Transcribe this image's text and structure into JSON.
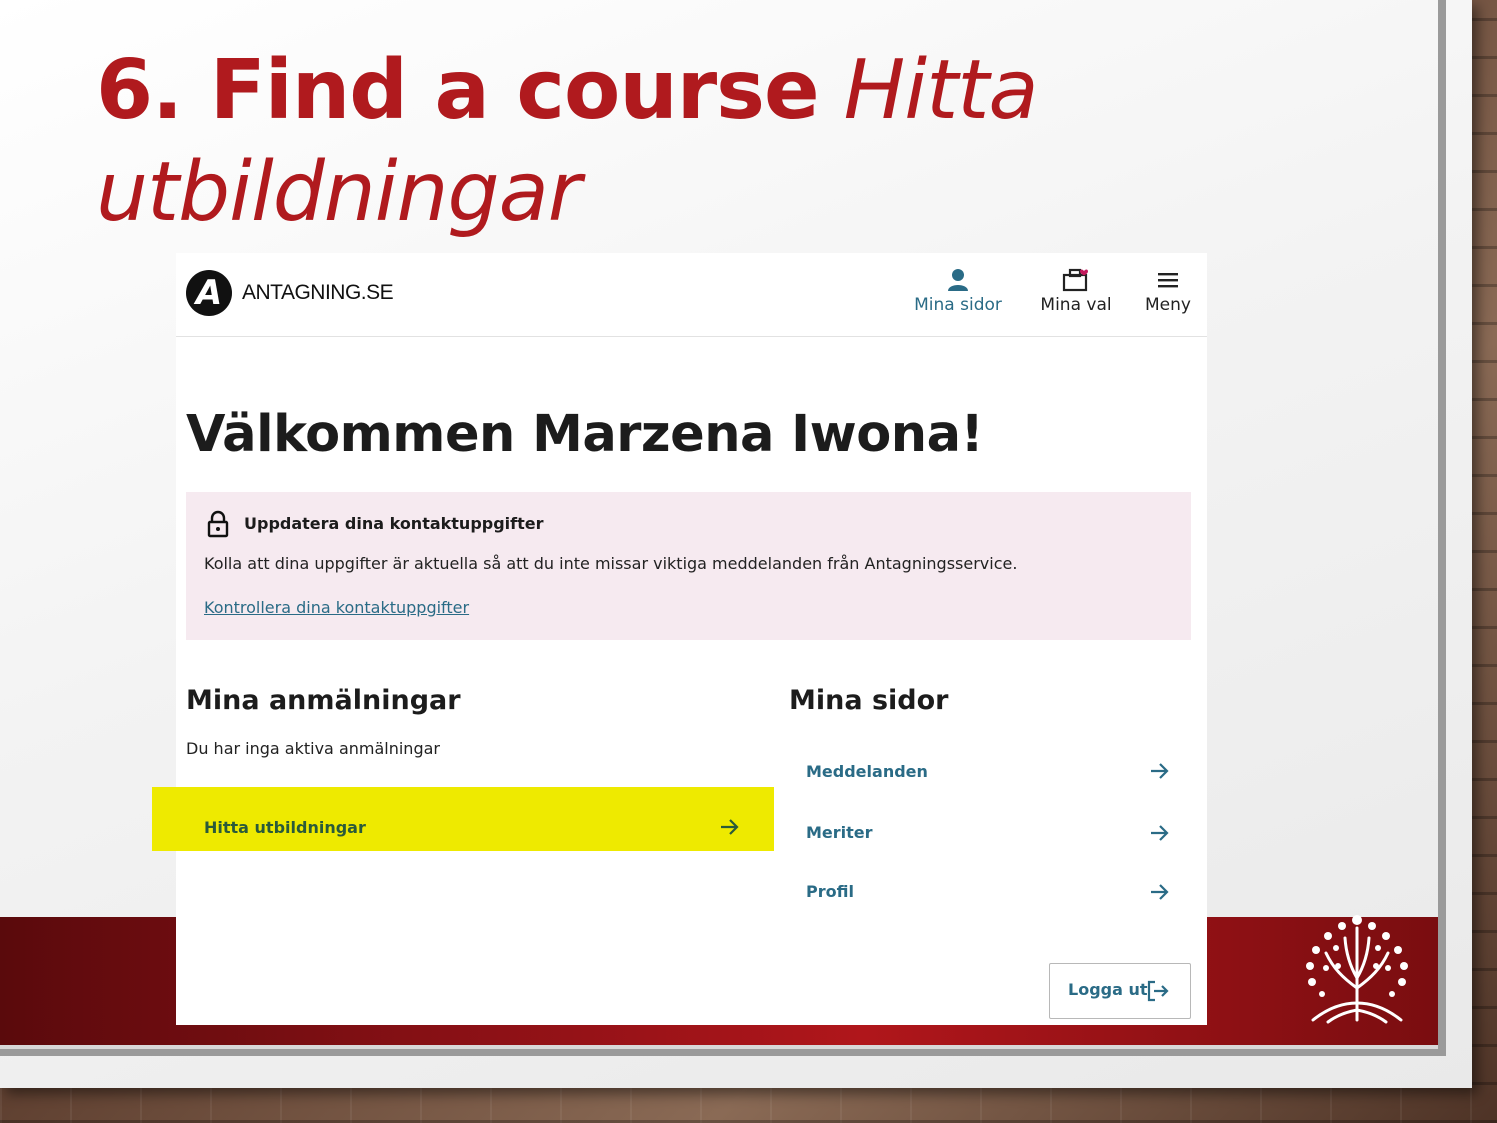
{
  "slide": {
    "title_bold": "6. Find a course",
    "title_italic": "Hitta utbildningar"
  },
  "site": {
    "logo_letter": "A",
    "brand": "ANTAGNING.SE",
    "nav": [
      {
        "label": "Mina sidor",
        "icon": "user-icon"
      },
      {
        "label": "Mina val",
        "icon": "briefcase-heart-icon"
      },
      {
        "label": "Meny",
        "icon": "hamburger-icon"
      }
    ]
  },
  "welcome": "Välkommen Marzena Iwona!",
  "notice": {
    "title": "Uppdatera dina kontaktuppgifter",
    "text": "Kolla att dina uppgifter är aktuella så att du inte missar viktiga meddelanden från Antagningsservice.",
    "link": "Kontrollera dina kontaktuppgifter"
  },
  "applications": {
    "heading": "Mina anmälningar",
    "empty": "Du har inga aktiva anmälningar",
    "find": "Hitta utbildningar"
  },
  "my_pages": {
    "heading": "Mina sidor",
    "links": [
      "Meddelanden",
      "Meriter",
      "Profil"
    ]
  },
  "logout": "Logga ut",
  "colors": {
    "accent": "#2a6b86",
    "highlight": "#eeea00",
    "title_red": "#b01a1e",
    "notice_bg": "#f6eaf0"
  }
}
